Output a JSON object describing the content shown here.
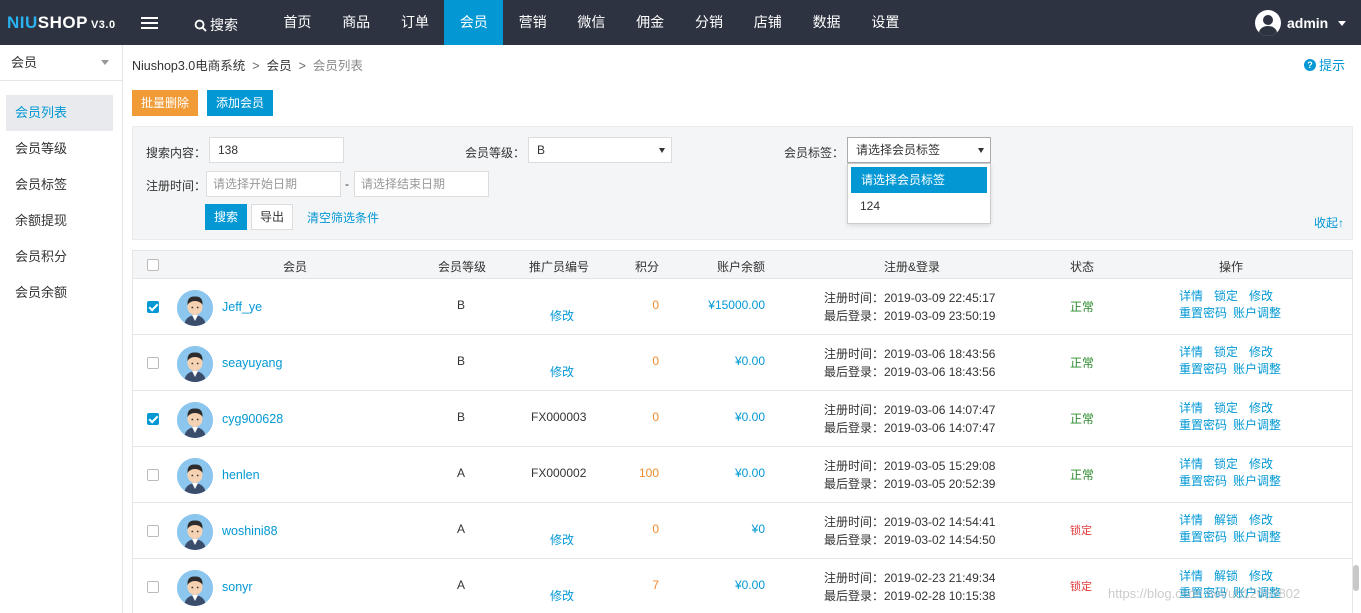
{
  "topbar": {
    "logo_prefix": "NIU",
    "logo_rest": "SHOP",
    "logo_version": "V3.0",
    "search_label": "搜索",
    "nav": [
      "首页",
      "商品",
      "订单",
      "会员",
      "营销",
      "微信",
      "佣金",
      "分销",
      "店铺",
      "数据",
      "设置"
    ],
    "active_nav": "会员",
    "user": "admin"
  },
  "sidebar": {
    "header": "会员",
    "items": [
      "会员列表",
      "会员等级",
      "会员标签",
      "余额提现",
      "会员积分",
      "会员余额"
    ],
    "active": "会员列表"
  },
  "breadcrumb": [
    "Niushop3.0电商系统",
    "会员",
    "会员列表"
  ],
  "tip_label": "提示",
  "actions": {
    "batch_delete": "批量删除",
    "add_member": "添加会员"
  },
  "filter": {
    "search_label": "搜索内容：",
    "search_value": "138",
    "level_label": "会员等级：",
    "level_value": "B",
    "tag_label": "会员标签：",
    "tag_value": "请选择会员标签",
    "tag_options": [
      "请选择会员标签",
      "124"
    ],
    "reg_time_label": "注册时间：",
    "start_placeholder": "请选择开始日期",
    "dash": "-",
    "end_placeholder": "请选择结束日期",
    "search_button": "搜索",
    "export_button": "导出",
    "clear_link": "清空筛选条件",
    "collapse_link": "收起↑"
  },
  "table": {
    "headers": [
      "会员",
      "会员等级",
      "推广员编号",
      "积分",
      "账户余额",
      "注册&登录",
      "状态",
      "操作"
    ],
    "rows": [
      {
        "checked": true,
        "name": "Jeff_ye",
        "level": "B",
        "promoter": "修改",
        "points": "0",
        "balance": "¥15000.00",
        "reg": "注册时间：2019-03-09 22:45:17",
        "login": "最后登录：2019-03-09 23:50:19",
        "status": "正常",
        "ops1": [
          "详情",
          "锁定",
          "修改"
        ],
        "ops2": [
          "重置密码",
          "账户调整"
        ]
      },
      {
        "checked": false,
        "name": "seayuyang",
        "level": "B",
        "promoter": "修改",
        "points": "0",
        "balance": "¥0.00",
        "reg": "注册时间：2019-03-06 18:43:56",
        "login": "最后登录：2019-03-06 18:43:56",
        "status": "正常",
        "ops1": [
          "详情",
          "锁定",
          "修改"
        ],
        "ops2": [
          "重置密码",
          "账户调整"
        ]
      },
      {
        "checked": true,
        "name": "cyg900628",
        "level": "B",
        "promoter": "FX000003",
        "points": "0",
        "balance": "¥0.00",
        "reg": "注册时间：2019-03-06 14:07:47",
        "login": "最后登录：2019-03-06 14:07:47",
        "status": "正常",
        "ops1": [
          "详情",
          "锁定",
          "修改"
        ],
        "ops2": [
          "重置密码",
          "账户调整"
        ]
      },
      {
        "checked": false,
        "name": "henlen",
        "level": "A",
        "promoter": "FX000002",
        "points": "100",
        "balance": "¥0.00",
        "reg": "注册时间：2019-03-05 15:29:08",
        "login": "最后登录：2019-03-05 20:52:39",
        "status": "正常",
        "ops1": [
          "详情",
          "锁定",
          "修改"
        ],
        "ops2": [
          "重置密码",
          "账户调整"
        ]
      },
      {
        "checked": false,
        "name": "woshini88",
        "level": "A",
        "promoter": "修改",
        "points": "0",
        "balance": "¥0",
        "reg": "注册时间：2019-03-02 14:54:41",
        "login": "最后登录：2019-03-02 14:54:50",
        "status": "锁定",
        "ops1": [
          "详情",
          "解锁",
          "修改"
        ],
        "ops2": [
          "重置密码",
          "账户调整"
        ]
      },
      {
        "checked": false,
        "name": "sonyr",
        "level": "A",
        "promoter": "修改",
        "points": "7",
        "balance": "¥0.00",
        "reg": "注册时间：2019-02-23 21:49:34",
        "login": "最后登录：2019-02-28 10:15:38",
        "status": "锁定",
        "ops1": [
          "详情",
          "解锁",
          "修改"
        ],
        "ops2": [
          "重置密码",
          "账户调整"
        ]
      }
    ]
  },
  "watermark": "https://blog.csdn.net/u012663802"
}
